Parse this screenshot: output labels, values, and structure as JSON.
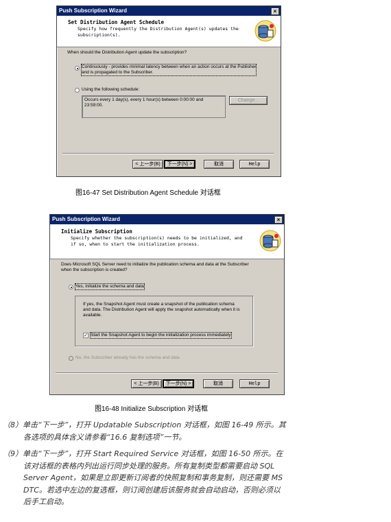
{
  "dialog1": {
    "title": "Push Subscription Wizard",
    "close_glyph": "×",
    "header_title": "Set Distribution Agent Schedule",
    "header_subtitle_1": "Specify how frequently the Distribution Agent(s) updates the",
    "header_subtitle_2": "subscription(s).",
    "header_icon": "database-wizard-icon",
    "question": "When should the Distribution Agent update the subscription?",
    "option_continuous_1": "Continuously - provides minimal latency between when an action occurs at the Publisher",
    "option_continuous_2": "and is propagated to the Subscriber.",
    "option_schedule": "Using the following schedule:",
    "schedule_text_1": "Occurs every 1 day(s), every 1 hour(s) between 0:00:00 and",
    "schedule_text_2": "23:59:00.",
    "change_button": "Change...",
    "back_button": "< 上一步(B)",
    "next_button": "下一步(N) >",
    "cancel_button": "取消",
    "help_button": "Help",
    "selected_option": "continuous"
  },
  "caption1": "图16-47  Set Distribution Agent Schedule 对话框",
  "dialog2": {
    "title": "Push Subscription Wizard",
    "close_glyph": "×",
    "header_title": "Initialize Subscription",
    "header_subtitle_1": "Specify whether the subscription(s) needs to be initialized, and",
    "header_subtitle_2": "if so, when to start the initialization process.",
    "header_icon": "database-wizard-icon",
    "question_1": "Does Microsoft SQL Server need to initialize the publication schema and data at the Subscriber",
    "question_2": "when the subscription is created?",
    "option_yes": "Yes, initialize the schema and data",
    "info_1": "If yes, the Snapshot Agent must create a snapshot of the publication schema",
    "info_2": "and data. The Distribution Agent will apply the snapshot automatically when it is",
    "info_3": "available.",
    "checkbox_label": "Start the Snapshot Agent to begin the initialization process immediately",
    "checkbox_checked": true,
    "option_no": "No, the Subscriber already has the schema and data",
    "back_button": "< 上一步(B)",
    "next_button": "下一步(N) >",
    "cancel_button": "取消",
    "help_button": "Help"
  },
  "caption2": "图16-48  Initialize Subscription 对话框",
  "steps": [
    {
      "num": "（8）",
      "line1": "单击“下一步”，打开 Updatable Subscription 对话框，如图 16-49 所示。其",
      "line2": "各选项的具体含义请参看“16.6 复制选项”一节。"
    },
    {
      "num": "（9）",
      "line1": "单击“下一步”，打开 Start Required Service 对话框，如图 16-50 所示。在",
      "line2": "该对话框的表格内列出运行同步处理的服务。所有复制类型都需要启动 SQL",
      "line3": "Server Agent，如果是立即更新订阅者的快照复制和事务复制，则还需要 MS",
      "line4": "DTC。若选中左边的复选框，则订阅创建后该服务就会自动启动，否则必须以",
      "line5": "后手工启动。"
    }
  ]
}
